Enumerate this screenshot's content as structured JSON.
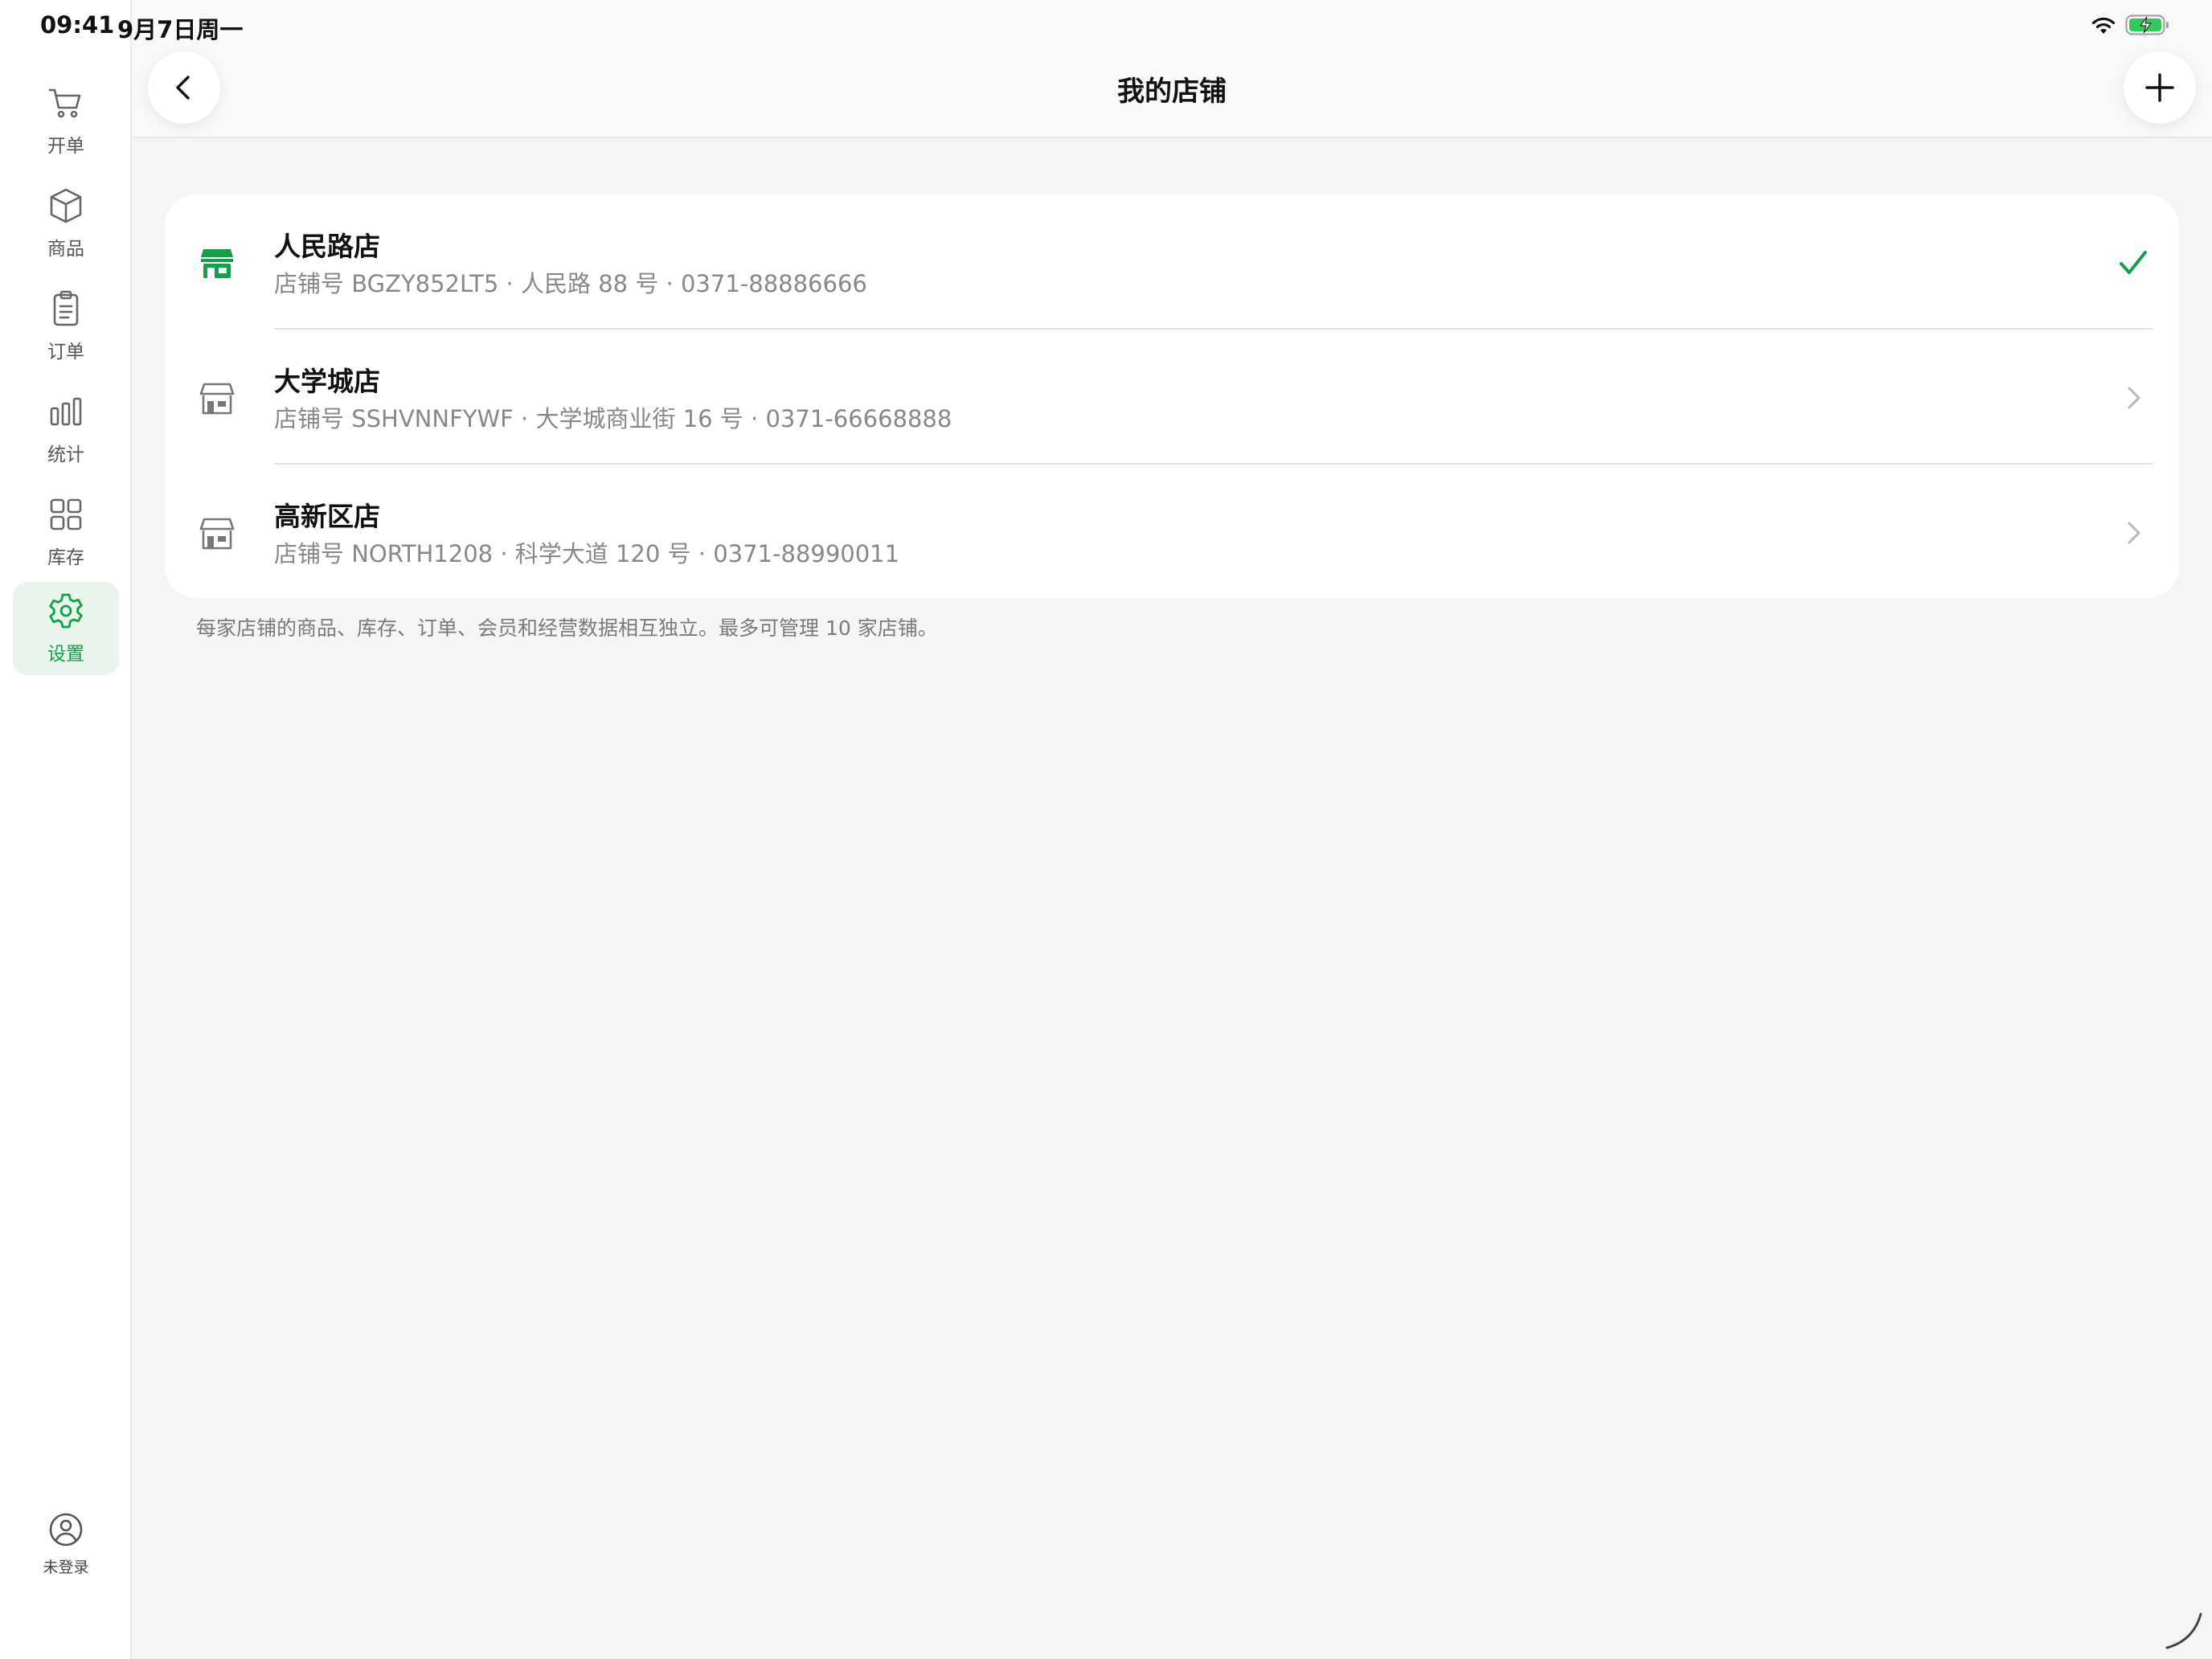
{
  "status_bar": {
    "time": "09:41",
    "date": "9月7日周一",
    "battery_color": "#34c759"
  },
  "sidebar": {
    "items": [
      {
        "label": "开单",
        "icon": "cart-icon",
        "active": false
      },
      {
        "label": "商品",
        "icon": "box-icon",
        "active": false
      },
      {
        "label": "订单",
        "icon": "clipboard-icon",
        "active": false
      },
      {
        "label": "统计",
        "icon": "bar-chart-icon",
        "active": false
      },
      {
        "label": "库存",
        "icon": "grid-icon",
        "active": false
      },
      {
        "label": "设置",
        "icon": "gear-icon",
        "active": true
      }
    ],
    "account_label": "未登录"
  },
  "header": {
    "title": "我的店铺",
    "back_icon": "chevron-left-icon",
    "add_icon": "plus-icon"
  },
  "stores": [
    {
      "name": "人民路店",
      "detail": "店铺号 BGZY852LT5 · 人民路 88 号 · 0371-88886666",
      "selected": true
    },
    {
      "name": "大学城店",
      "detail": "店铺号 SSHVNNFYWF · 大学城商业街 16 号 · 0371-66668888",
      "selected": false
    },
    {
      "name": "高新区店",
      "detail": "店铺号 NORTH1208 · 科学大道 120 号 · 0371-88990011",
      "selected": false
    }
  ],
  "footer_note": "每家店铺的商品、库存、订单、会员和经营数据相互独立。最多可管理 10 家店铺。",
  "colors": {
    "accent": "#11a14a",
    "active_bg": "#e8f4ec",
    "secondary_text": "#888888"
  }
}
